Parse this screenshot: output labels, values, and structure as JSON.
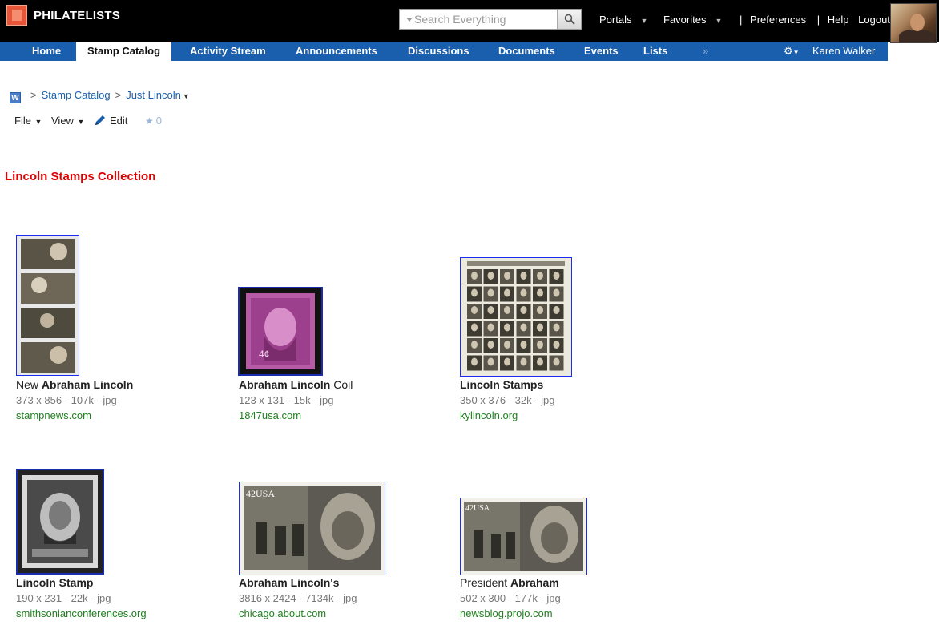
{
  "app": {
    "title": "PHILATELISTS"
  },
  "search": {
    "placeholder": "Search Everything"
  },
  "toplinks": {
    "portals": "Portals",
    "favorites": "Favorites",
    "preferences": "Preferences",
    "help": "Help",
    "logout": "Logout"
  },
  "nav": {
    "items": [
      "Home",
      "Stamp Catalog",
      "Activity Stream",
      "Announcements",
      "Discussions",
      "Documents",
      "Events",
      "Lists"
    ],
    "active": "Stamp Catalog",
    "more": "»",
    "user": "Karen Walker"
  },
  "breadcrumb": {
    "icon_letter": "W",
    "items": [
      "Stamp Catalog",
      "Just Lincoln"
    ]
  },
  "toolbar": {
    "file": "File",
    "view": "View",
    "edit": "Edit",
    "rating_count": "0"
  },
  "page": {
    "heading": "Lincoln Stamps Collection"
  },
  "results": [
    {
      "title_pre": "New ",
      "title_bold": "Abraham Lincoln",
      "title_post": "",
      "meta": "373 x 856 - 107k - jpg",
      "host": "stampnews.com"
    },
    {
      "title_pre": "",
      "title_bold": "Abraham Lincoln",
      "title_post": " Coil",
      "meta": "123 x 131 - 15k - jpg",
      "host": "1847usa.com"
    },
    {
      "title_pre": "",
      "title_bold": "Lincoln Stamps",
      "title_post": "",
      "meta": "350 x 376 - 32k - jpg",
      "host": "kylincoln.org"
    },
    {
      "title_pre": "",
      "title_bold": "Lincoln Stamp",
      "title_post": "",
      "meta": "190 x 231 - 22k - jpg",
      "host": "smithsonianconferences.org"
    },
    {
      "title_pre": "",
      "title_bold": "Abraham Lincoln's",
      "title_post": "",
      "meta": "3816 x 2424 - 7134k - jpg",
      "host": "chicago.about.com"
    },
    {
      "title_pre": "President ",
      "title_bold": "Abraham",
      "title_post": "",
      "meta": "502 x 300 - 177k - jpg",
      "host": "newsblog.projo.com"
    }
  ],
  "colors": {
    "topbar": "#000000",
    "navbar": "#1a5fad",
    "heading": "#e00000",
    "link": "#1a5fad",
    "host": "#208020",
    "thumb_border": "#1a2cf0"
  },
  "icons": {
    "search": "magnifier-icon",
    "gear": "gear-icon",
    "edit": "pencil-icon",
    "star": "star-icon"
  }
}
